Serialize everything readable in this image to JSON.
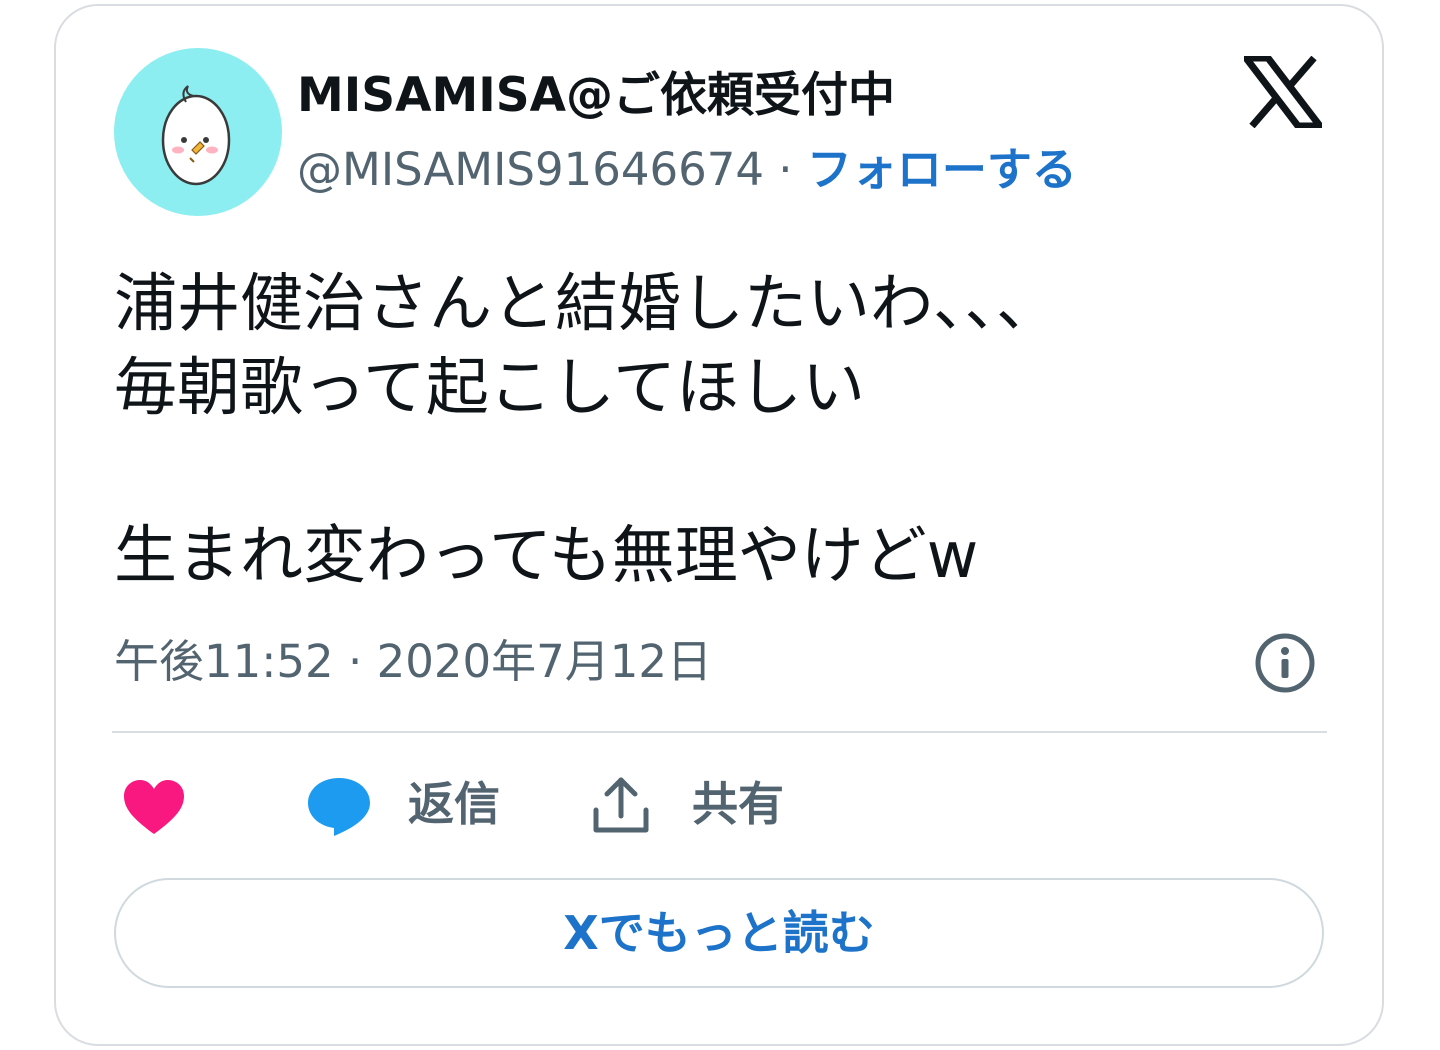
{
  "user": {
    "display_name": "MISAMISA@ご依頼受付中",
    "handle": "@MISAMIS91646674",
    "separator": " · ",
    "follow_label": "フォローする",
    "avatar_bg": "#8ceef0"
  },
  "tweet": {
    "lines": [
      "浦井健治さんと結婚したいわ、、、",
      "毎朝歌って起こしてほしい",
      "生まれ変わっても無理やけどw"
    ],
    "timestamp": "午後11:52 · 2020年7月12日"
  },
  "actions": {
    "like_icon": "heart-icon",
    "like_color": "#f91880",
    "reply_label": "返信",
    "reply_icon": "speech-bubble-icon",
    "reply_color": "#1d9bf0",
    "share_label": "共有",
    "share_icon": "share-upload-icon"
  },
  "read_more_label": "Xでもっと読む",
  "colors": {
    "text": "#0f1419",
    "muted": "#536471",
    "link": "#1d73c9",
    "border": "#d9dde1"
  }
}
